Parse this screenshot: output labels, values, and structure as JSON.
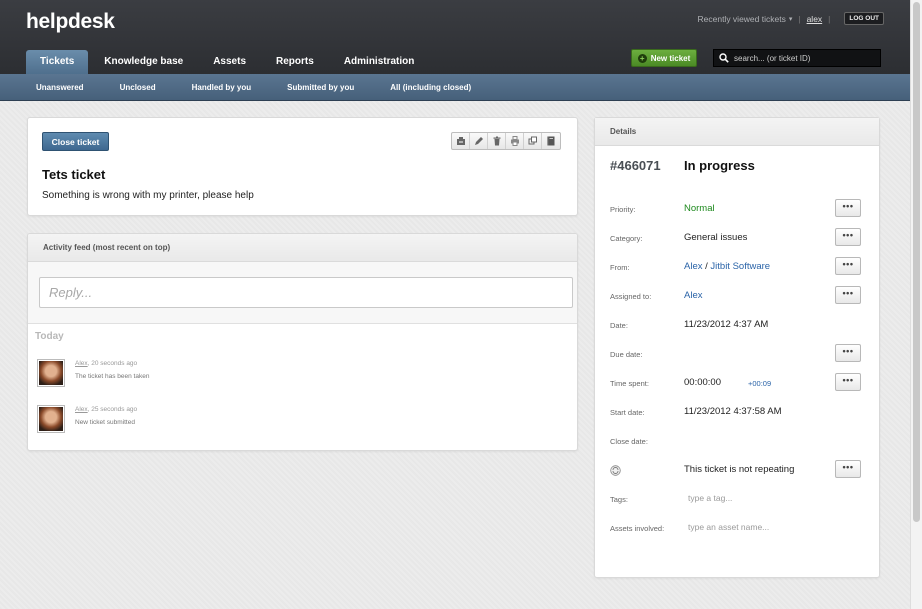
{
  "app": {
    "logo": "helpdesk"
  },
  "userbar": {
    "recent": "Recently viewed tickets",
    "caret": "▾",
    "sep": "|",
    "sep2": "|",
    "username": "alex",
    "logout": "LOG OUT"
  },
  "tabs": [
    {
      "label": "Tickets",
      "active": true
    },
    {
      "label": "Knowledge base",
      "active": false
    },
    {
      "label": "Assets",
      "active": false
    },
    {
      "label": "Reports",
      "active": false
    },
    {
      "label": "Administration",
      "active": false
    }
  ],
  "new_ticket": {
    "label": "New ticket",
    "plus": "+"
  },
  "search": {
    "placeholder": "search... (or ticket ID)"
  },
  "subnav": [
    "Unanswered",
    "Unclosed",
    "Handled by you",
    "Submitted by you",
    "All (including closed)"
  ],
  "ticket": {
    "close_label": "Close ticket",
    "title": "Tets ticket",
    "description": "Something is wrong with my printer, please help"
  },
  "toolbar": [
    "merge-icon",
    "edit-icon",
    "delete-icon",
    "print-icon",
    "copy-icon",
    "notebook-icon"
  ],
  "feed": {
    "header": "Activity feed (most recent on top)",
    "reply_placeholder": "Reply...",
    "today": "Today",
    "items": [
      {
        "user": "Alex",
        "time": ", 20 seconds ago",
        "text": "The ticket has been taken"
      },
      {
        "user": "Alex",
        "time": ", 25 seconds ago",
        "text": "New ticket submitted"
      }
    ]
  },
  "details": {
    "header": "Details",
    "id": "#466071",
    "status": "In progress",
    "more_label": "•••",
    "priority": {
      "label": "Priority:",
      "value": "Normal"
    },
    "category": {
      "label": "Category:",
      "value": "General issues"
    },
    "from": {
      "label": "From:",
      "user": "Alex",
      "sep": " / ",
      "company": "Jitbit Software"
    },
    "assigned": {
      "label": "Assigned to:",
      "value": "Alex"
    },
    "date": {
      "label": "Date:",
      "value": "11/23/2012 4:37 AM"
    },
    "due": {
      "label": "Due date:"
    },
    "time_spent": {
      "label": "Time spent:",
      "value": "00:00:00",
      "extra": "+00:09"
    },
    "start": {
      "label": "Start date:",
      "value": "11/23/2012 4:37:58 AM"
    },
    "close": {
      "label": "Close date:"
    },
    "repeat": {
      "value": "This ticket is not repeating"
    },
    "tags": {
      "label": "Tags:",
      "placeholder": "type a tag..."
    },
    "assets": {
      "label": "Assets involved:",
      "placeholder": "type an asset name..."
    }
  },
  "colors": {
    "header_bg": "#33353a",
    "accent_blue": "#4f6f8d",
    "green_button": "#5a9c30",
    "link": "#2b64a8",
    "priority_green": "#1e8a1e"
  }
}
